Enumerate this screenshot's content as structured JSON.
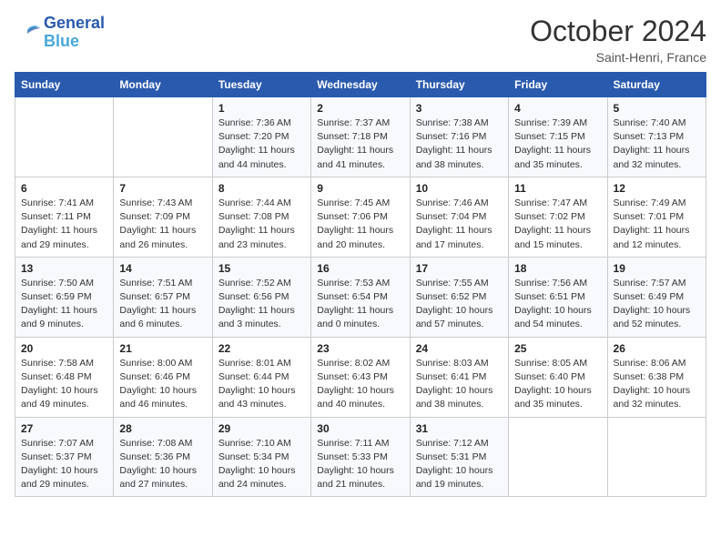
{
  "header": {
    "logo_line1": "General",
    "logo_line2": "Blue",
    "month": "October 2024",
    "location": "Saint-Henri, France"
  },
  "weekdays": [
    "Sunday",
    "Monday",
    "Tuesday",
    "Wednesday",
    "Thursday",
    "Friday",
    "Saturday"
  ],
  "weeks": [
    [
      {
        "day": "",
        "info": ""
      },
      {
        "day": "",
        "info": ""
      },
      {
        "day": "1",
        "info": "Sunrise: 7:36 AM\nSunset: 7:20 PM\nDaylight: 11 hours\nand 44 minutes."
      },
      {
        "day": "2",
        "info": "Sunrise: 7:37 AM\nSunset: 7:18 PM\nDaylight: 11 hours\nand 41 minutes."
      },
      {
        "day": "3",
        "info": "Sunrise: 7:38 AM\nSunset: 7:16 PM\nDaylight: 11 hours\nand 38 minutes."
      },
      {
        "day": "4",
        "info": "Sunrise: 7:39 AM\nSunset: 7:15 PM\nDaylight: 11 hours\nand 35 minutes."
      },
      {
        "day": "5",
        "info": "Sunrise: 7:40 AM\nSunset: 7:13 PM\nDaylight: 11 hours\nand 32 minutes."
      }
    ],
    [
      {
        "day": "6",
        "info": "Sunrise: 7:41 AM\nSunset: 7:11 PM\nDaylight: 11 hours\nand 29 minutes."
      },
      {
        "day": "7",
        "info": "Sunrise: 7:43 AM\nSunset: 7:09 PM\nDaylight: 11 hours\nand 26 minutes."
      },
      {
        "day": "8",
        "info": "Sunrise: 7:44 AM\nSunset: 7:08 PM\nDaylight: 11 hours\nand 23 minutes."
      },
      {
        "day": "9",
        "info": "Sunrise: 7:45 AM\nSunset: 7:06 PM\nDaylight: 11 hours\nand 20 minutes."
      },
      {
        "day": "10",
        "info": "Sunrise: 7:46 AM\nSunset: 7:04 PM\nDaylight: 11 hours\nand 17 minutes."
      },
      {
        "day": "11",
        "info": "Sunrise: 7:47 AM\nSunset: 7:02 PM\nDaylight: 11 hours\nand 15 minutes."
      },
      {
        "day": "12",
        "info": "Sunrise: 7:49 AM\nSunset: 7:01 PM\nDaylight: 11 hours\nand 12 minutes."
      }
    ],
    [
      {
        "day": "13",
        "info": "Sunrise: 7:50 AM\nSunset: 6:59 PM\nDaylight: 11 hours\nand 9 minutes."
      },
      {
        "day": "14",
        "info": "Sunrise: 7:51 AM\nSunset: 6:57 PM\nDaylight: 11 hours\nand 6 minutes."
      },
      {
        "day": "15",
        "info": "Sunrise: 7:52 AM\nSunset: 6:56 PM\nDaylight: 11 hours\nand 3 minutes."
      },
      {
        "day": "16",
        "info": "Sunrise: 7:53 AM\nSunset: 6:54 PM\nDaylight: 11 hours\nand 0 minutes."
      },
      {
        "day": "17",
        "info": "Sunrise: 7:55 AM\nSunset: 6:52 PM\nDaylight: 10 hours\nand 57 minutes."
      },
      {
        "day": "18",
        "info": "Sunrise: 7:56 AM\nSunset: 6:51 PM\nDaylight: 10 hours\nand 54 minutes."
      },
      {
        "day": "19",
        "info": "Sunrise: 7:57 AM\nSunset: 6:49 PM\nDaylight: 10 hours\nand 52 minutes."
      }
    ],
    [
      {
        "day": "20",
        "info": "Sunrise: 7:58 AM\nSunset: 6:48 PM\nDaylight: 10 hours\nand 49 minutes."
      },
      {
        "day": "21",
        "info": "Sunrise: 8:00 AM\nSunset: 6:46 PM\nDaylight: 10 hours\nand 46 minutes."
      },
      {
        "day": "22",
        "info": "Sunrise: 8:01 AM\nSunset: 6:44 PM\nDaylight: 10 hours\nand 43 minutes."
      },
      {
        "day": "23",
        "info": "Sunrise: 8:02 AM\nSunset: 6:43 PM\nDaylight: 10 hours\nand 40 minutes."
      },
      {
        "day": "24",
        "info": "Sunrise: 8:03 AM\nSunset: 6:41 PM\nDaylight: 10 hours\nand 38 minutes."
      },
      {
        "day": "25",
        "info": "Sunrise: 8:05 AM\nSunset: 6:40 PM\nDaylight: 10 hours\nand 35 minutes."
      },
      {
        "day": "26",
        "info": "Sunrise: 8:06 AM\nSunset: 6:38 PM\nDaylight: 10 hours\nand 32 minutes."
      }
    ],
    [
      {
        "day": "27",
        "info": "Sunrise: 7:07 AM\nSunset: 5:37 PM\nDaylight: 10 hours\nand 29 minutes."
      },
      {
        "day": "28",
        "info": "Sunrise: 7:08 AM\nSunset: 5:36 PM\nDaylight: 10 hours\nand 27 minutes."
      },
      {
        "day": "29",
        "info": "Sunrise: 7:10 AM\nSunset: 5:34 PM\nDaylight: 10 hours\nand 24 minutes."
      },
      {
        "day": "30",
        "info": "Sunrise: 7:11 AM\nSunset: 5:33 PM\nDaylight: 10 hours\nand 21 minutes."
      },
      {
        "day": "31",
        "info": "Sunrise: 7:12 AM\nSunset: 5:31 PM\nDaylight: 10 hours\nand 19 minutes."
      },
      {
        "day": "",
        "info": ""
      },
      {
        "day": "",
        "info": ""
      }
    ]
  ]
}
